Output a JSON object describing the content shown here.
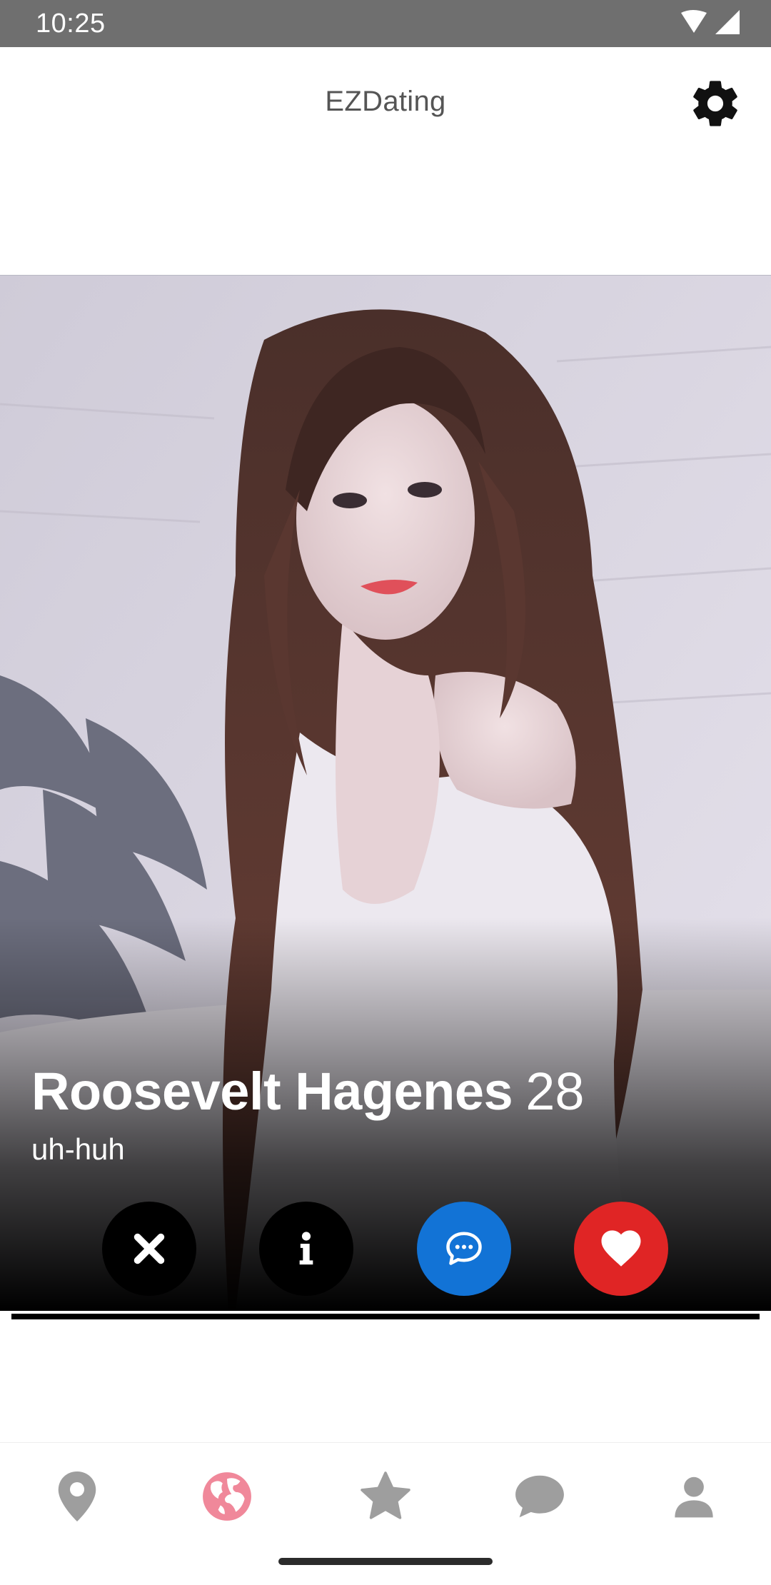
{
  "status_bar": {
    "time": "10:25",
    "icons": [
      "wifi-icon",
      "cell-signal-icon"
    ]
  },
  "app_bar": {
    "title": "EZDating",
    "settings_icon": "gear-icon"
  },
  "profile_card": {
    "name": "Roosevelt Hagenes",
    "age": "28",
    "bio": "uh-huh",
    "photo": "profile-photo"
  },
  "actions": [
    {
      "name": "dislike",
      "icon": "close-icon",
      "color": "#000000"
    },
    {
      "name": "info",
      "icon": "info-icon",
      "color": "#000000"
    },
    {
      "name": "message",
      "icon": "chat-bubble-icon",
      "color": "#1273d6"
    },
    {
      "name": "like",
      "icon": "heart-icon",
      "color": "#e02525"
    }
  ],
  "bottom_nav": {
    "items": [
      {
        "name": "nearby",
        "icon": "location-pin-icon",
        "active": false
      },
      {
        "name": "explore",
        "icon": "globe-icon",
        "active": true
      },
      {
        "name": "favorites",
        "icon": "star-icon",
        "active": false
      },
      {
        "name": "chats",
        "icon": "chat-icon",
        "active": false
      },
      {
        "name": "profile",
        "icon": "person-icon",
        "active": false
      }
    ],
    "active_color": "#f0889a",
    "inactive_color": "#9e9e9e"
  }
}
